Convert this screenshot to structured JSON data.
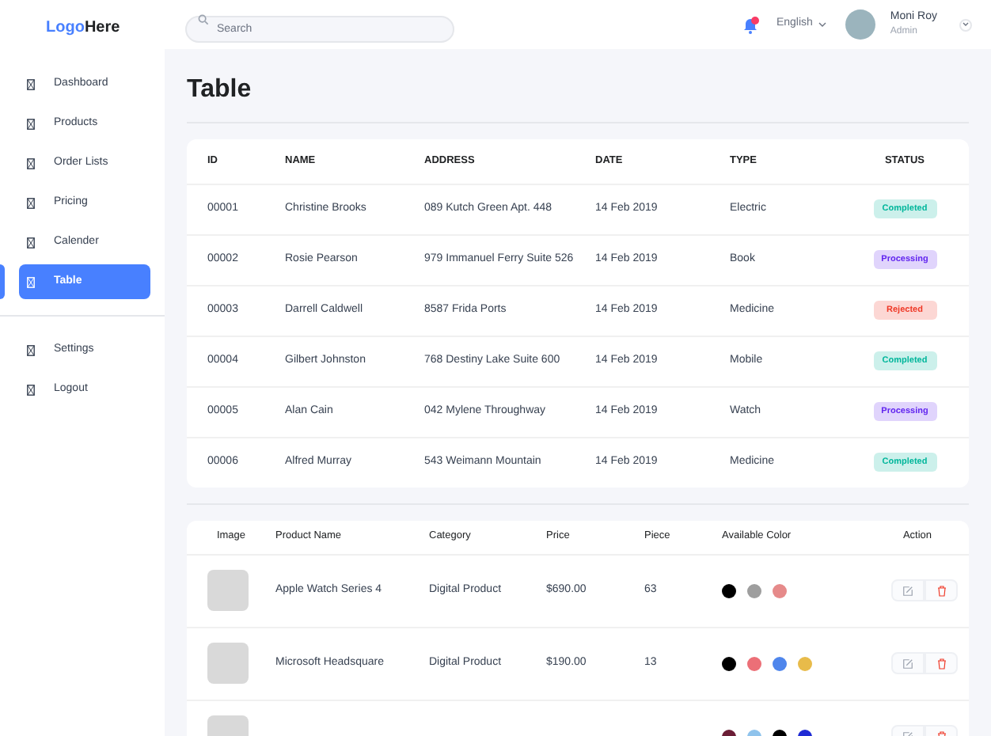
{
  "logo": {
    "part_1": "Logo",
    "part_2": "Here"
  },
  "search": {
    "placeholder": "Search"
  },
  "header": {
    "notifications": {
      "unread": true
    },
    "language": "English",
    "user": {
      "name": "Moni Roy",
      "role": "Admin"
    }
  },
  "sidebar": {
    "items": [
      {
        "label": "Dashboard",
        "selected": false
      },
      {
        "label": "Products",
        "selected": false
      },
      {
        "label": "Order Lists",
        "selected": false
      },
      {
        "label": "Pricing",
        "selected": false
      },
      {
        "label": "Calender",
        "selected": false
      },
      {
        "label": "Table",
        "selected": true
      }
    ],
    "bottom_items": [
      {
        "label": "Settings",
        "selected": false
      },
      {
        "label": "Logout",
        "selected": false
      }
    ]
  },
  "page_title": "Table",
  "orders_table": {
    "columns": [
      "ID",
      "NAME",
      "ADDRESS",
      "DATE",
      "TYPE",
      "STATUS"
    ],
    "rows": [
      {
        "id": "00001",
        "name": "Christine Brooks",
        "address": "089 Kutch Green Apt. 448",
        "date": "14 Feb 2019",
        "type": "Electric",
        "status": "Completed",
        "color": "#00b69b"
      },
      {
        "id": "00002",
        "name": "Rosie Pearson",
        "address": "979 Immanuel Ferry Suite 526",
        "date": "14 Feb 2019",
        "type": "Book",
        "status": "Processing",
        "color": "#6226ef"
      },
      {
        "id": "00003",
        "name": "Darrell Caldwell",
        "address": "8587 Frida Ports",
        "date": "14 Feb 2019",
        "type": "Medicine",
        "status": "Rejected",
        "color": "#ef3826"
      },
      {
        "id": "00004",
        "name": "Gilbert Johnston",
        "address": "768 Destiny Lake Suite 600",
        "date": "14 Feb 2019",
        "type": "Mobile",
        "status": "Completed",
        "color": "#00b69b"
      },
      {
        "id": "00005",
        "name": "Alan Cain",
        "address": "042 Mylene Throughway",
        "date": "14 Feb 2019",
        "type": "Watch",
        "status": "Processing",
        "color": "#6226ef"
      },
      {
        "id": "00006",
        "name": "Alfred Murray",
        "address": "543 Weimann Mountain",
        "date": "14 Feb 2019",
        "type": "Medicine",
        "status": "Completed",
        "color": "#00b69b"
      }
    ]
  },
  "products_table": {
    "columns": [
      "Image",
      "Product Name",
      "Category",
      "Price",
      "Piece",
      "Available Color",
      "Action"
    ],
    "rows": [
      {
        "name": "Apple Watch Series 4",
        "category": "Digital Product",
        "price": "$690.00",
        "piece": "63",
        "colors": [
          {
            "color": "#000000"
          },
          {
            "color": "#9e9e9e"
          },
          {
            "color": "#e68a8a"
          }
        ]
      },
      {
        "name": "Microsoft Headsquare",
        "category": "Digital Product",
        "price": "$190.00",
        "piece": "13",
        "colors": [
          {
            "color": "#000000"
          },
          {
            "color": "#ec6f77"
          },
          {
            "color": "#4f86ec"
          },
          {
            "color": "#e8bb4a"
          }
        ]
      },
      {
        "colors": [
          {
            "color": "#6b1e36"
          },
          {
            "color": "#8fc3ec"
          },
          {
            "color": "#000000"
          },
          {
            "color": "#1f2bd4"
          }
        ]
      }
    ]
  }
}
